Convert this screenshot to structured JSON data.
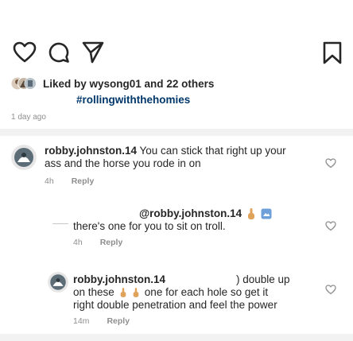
{
  "post": {
    "likes": {
      "prefix": "Liked by ",
      "username": "wysong01",
      "connector": " and ",
      "others": "22 others"
    },
    "hashtag": "#rollingwiththehomies",
    "time_ago": "1 day ago"
  },
  "icons": {
    "like": "heart-icon",
    "comment": "comment-icon",
    "share": "send-icon",
    "save": "bookmark-icon"
  },
  "comments": [
    {
      "username": "robby.johnston.14",
      "line1": " You can stick that right up your",
      "line2": "ass and the horse you rode in on",
      "time": "4h",
      "reply_label": "Reply"
    },
    {
      "mention": "@robby.johnston.14",
      "line2": "there's one for you to sit on troll.",
      "time": "4h",
      "reply_label": "Reply"
    },
    {
      "username": "robby.johnston.14",
      "line1_tail": ") double up",
      "line2": "on these",
      "line2b": "one for each hole so get it",
      "line3": "right double penetration and feel the power",
      "time": "14m",
      "reply_label": "Reply"
    }
  ],
  "colors": {
    "text": "#262626",
    "muted": "#8e8e8e",
    "link": "#00376b"
  }
}
